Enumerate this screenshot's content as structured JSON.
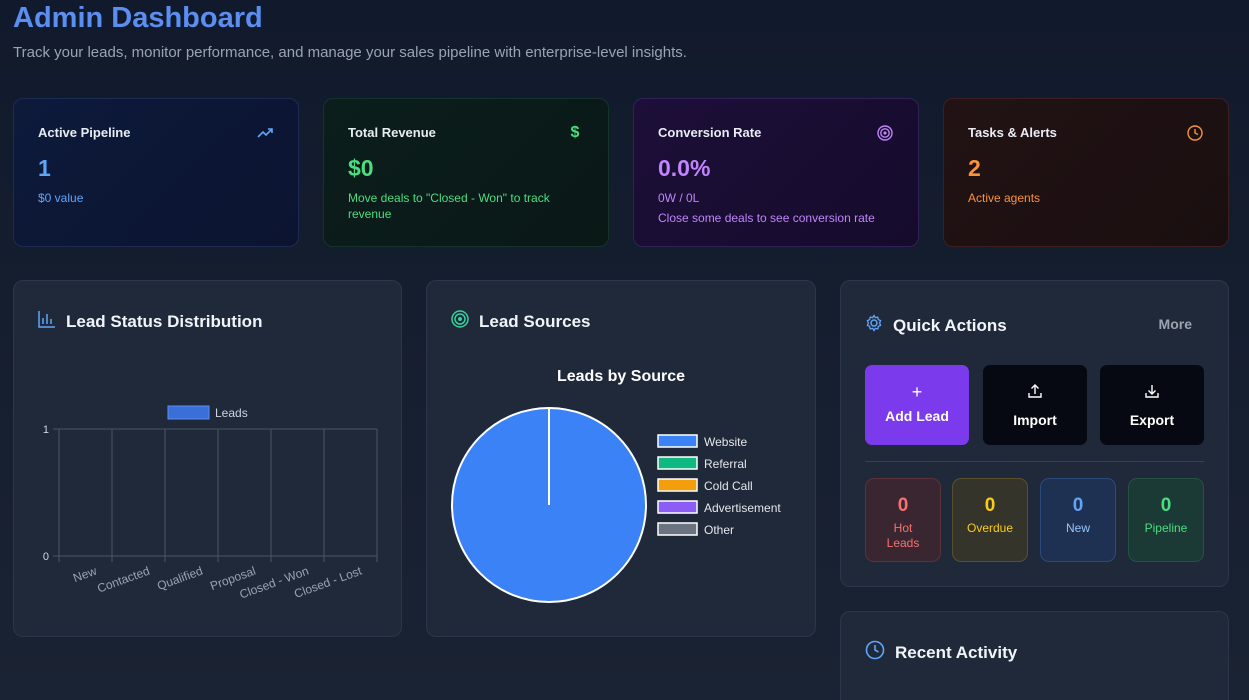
{
  "header": {
    "title": "Admin Dashboard",
    "subtitle": "Track your leads, monitor performance, and manage your sales pipeline with enterprise-level insights."
  },
  "stats": [
    {
      "title": "Active Pipeline",
      "value": "1",
      "sub": "$0 value",
      "icon": "trending-up-icon"
    },
    {
      "title": "Total Revenue",
      "value": "$0",
      "sub": "Move deals to \"Closed - Won\" to track revenue",
      "icon": "dollar-icon"
    },
    {
      "title": "Conversion Rate",
      "value": "0.0%",
      "sub": "0W / 0L",
      "sub2": "Close some deals to see conversion rate",
      "icon": "target-icon"
    },
    {
      "title": "Tasks & Alerts",
      "value": "2",
      "sub": "Active agents",
      "icon": "clock-icon"
    }
  ],
  "lead_status": {
    "title": "Lead Status Distribution",
    "icon": "bar-chart-icon"
  },
  "lead_sources": {
    "title": "Lead Sources",
    "icon": "target-icon"
  },
  "quick_actions": {
    "title": "Quick Actions",
    "more": "More",
    "buttons": [
      {
        "label": "Add Lead",
        "icon": "plus-icon"
      },
      {
        "label": "Import",
        "icon": "upload-icon"
      },
      {
        "label": "Export",
        "icon": "download-icon"
      }
    ],
    "counters": [
      {
        "value": "0",
        "label": "Hot Leads",
        "color": "#f87171"
      },
      {
        "value": "0",
        "label": "Overdue",
        "color": "#facc15"
      },
      {
        "value": "0",
        "label": "New",
        "color": "#60a5fa"
      },
      {
        "value": "0",
        "label": "Pipeline",
        "color": "#4ade80"
      }
    ]
  },
  "recent_activity": {
    "title": "Recent Activity",
    "icon": "clock-icon"
  },
  "chart_data": [
    {
      "type": "bar",
      "title": "",
      "categories": [
        "New",
        "Contacted",
        "Qualified",
        "Proposal",
        "Closed - Won",
        "Closed - Lost"
      ],
      "series": [
        {
          "name": "Leads",
          "values": [
            0,
            0,
            0,
            0,
            0,
            0
          ],
          "color": "#3b6fd8"
        }
      ],
      "ylim": [
        0,
        1
      ],
      "yticks": [
        "1",
        "0"
      ],
      "legend": "top"
    },
    {
      "type": "pie",
      "title": "Leads by Source",
      "labels": [
        "Website",
        "Referral",
        "Cold Call",
        "Advertisement",
        "Other"
      ],
      "values": [
        1,
        0,
        0,
        0,
        0
      ],
      "colors": [
        "#3b82f6",
        "#10b981",
        "#f59e0b",
        "#8b5cf6",
        "#6b7280"
      ],
      "legend": "right"
    }
  ]
}
